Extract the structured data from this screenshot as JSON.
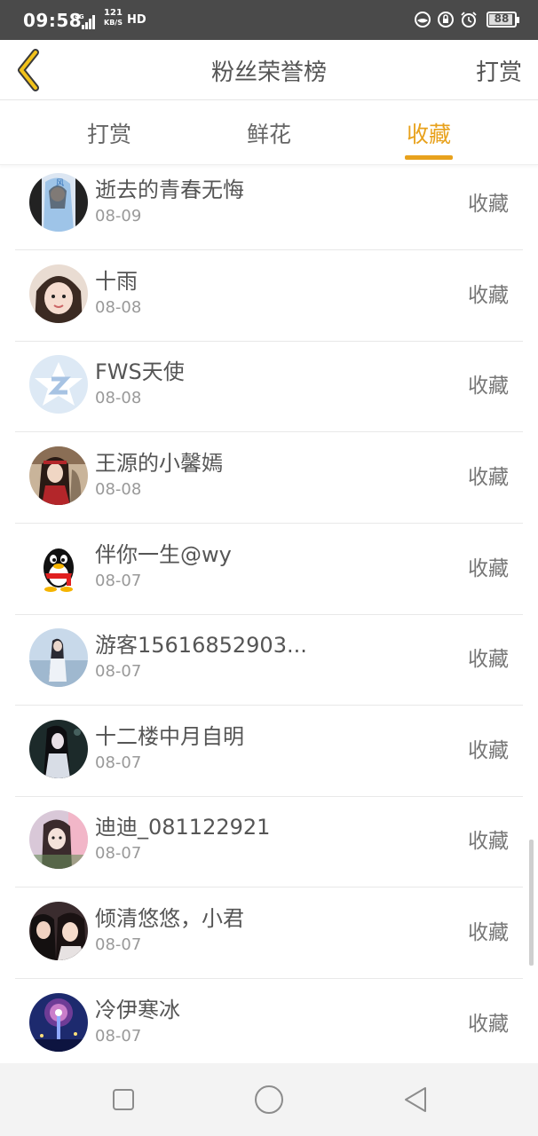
{
  "status_bar": {
    "time": "09:58",
    "network": "4G",
    "speed_value": "121",
    "speed_unit": "KB/S",
    "hd": "HD",
    "battery": "88",
    "battery_level": 0.88,
    "icons": [
      "signal-icon",
      "mask-icon",
      "lock-rotation-icon",
      "alarm-icon",
      "battery-icon"
    ]
  },
  "header": {
    "title": "粉丝荣誉榜",
    "right_link": "打赏",
    "back_icon": "chevron-left-icon",
    "accent": "#e8a21d"
  },
  "tabs": [
    {
      "label": "打赏",
      "active": false
    },
    {
      "label": "鲜花",
      "active": false
    },
    {
      "label": "收藏",
      "active": true
    }
  ],
  "fans": [
    {
      "name": "逝去的青春无悔",
      "date": "08-09",
      "action": "收藏",
      "avatar": "anime-avatar"
    },
    {
      "name": "十雨",
      "date": "08-08",
      "action": "收藏",
      "avatar": "girl-avatar"
    },
    {
      "name": "FWS天使",
      "date": "08-08",
      "action": "收藏",
      "avatar": "qzone-star-avatar"
    },
    {
      "name": "王源的小馨嫣",
      "date": "08-08",
      "action": "收藏",
      "avatar": "costume-avatar"
    },
    {
      "name": "伴你一生@wy",
      "date": "08-07",
      "action": "收藏",
      "avatar": "qq-penguin-avatar"
    },
    {
      "name": "游客15616852903...",
      "date": "08-07",
      "action": "收藏",
      "avatar": "sea-girl-avatar"
    },
    {
      "name": "十二楼中月自明",
      "date": "08-07",
      "action": "收藏",
      "avatar": "dark-anime-avatar"
    },
    {
      "name": "迪迪_081122921",
      "date": "08-07",
      "action": "收藏",
      "avatar": "selfie-avatar"
    },
    {
      "name": "倾清悠悠，小君",
      "date": "08-07",
      "action": "收藏",
      "avatar": "two-girls-avatar"
    },
    {
      "name": "冷伊寒冰",
      "date": "08-07",
      "action": "收藏",
      "avatar": "fireworks-avatar"
    }
  ],
  "nav_bar": {
    "icons": [
      "recent-apps-icon",
      "home-icon",
      "back-triangle-icon"
    ]
  }
}
